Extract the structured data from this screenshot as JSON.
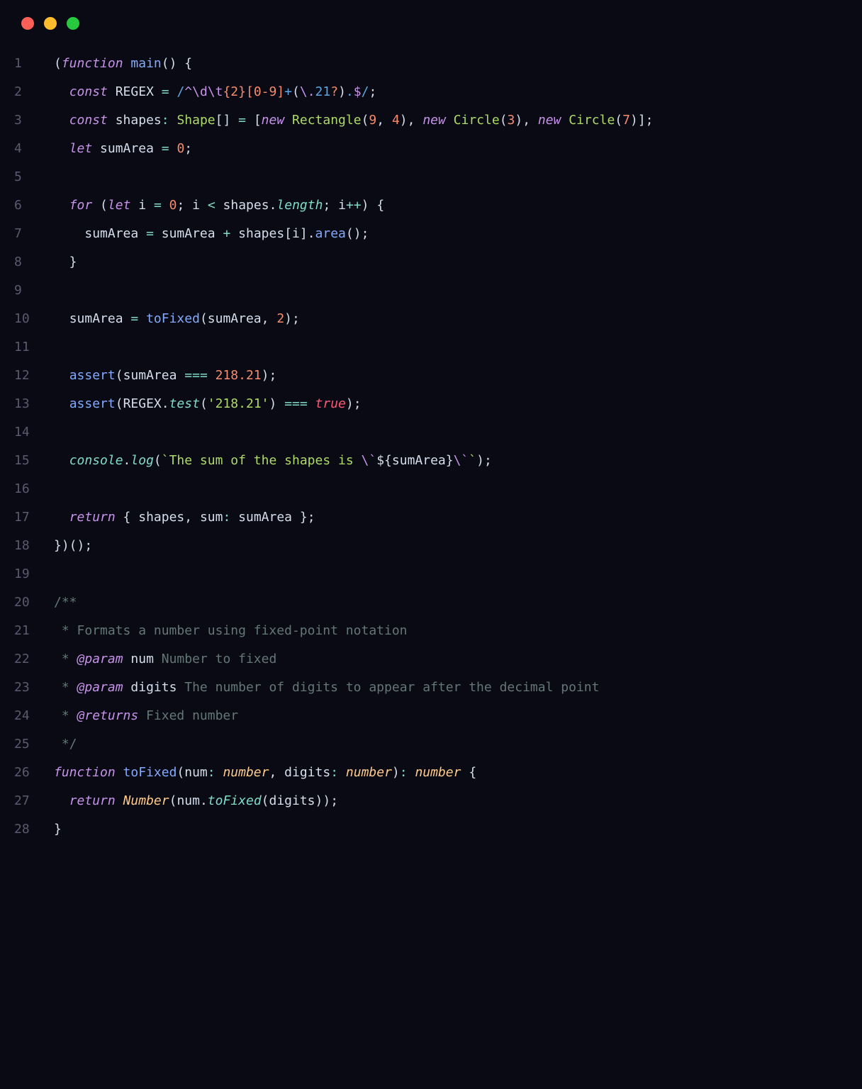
{
  "traffic": {
    "red": "#ff5f56",
    "yellow": "#ffbd2e",
    "green": "#27c93f"
  },
  "lineCount": 28,
  "tokens": {
    "l1": [
      [
        "punc",
        "("
      ],
      [
        "kw-it",
        "function"
      ],
      [
        "punc",
        " "
      ],
      [
        "callfn",
        "main"
      ],
      [
        "punc",
        "() {"
      ]
    ],
    "l2": [
      [
        "punc",
        "  "
      ],
      [
        "kw-it",
        "const"
      ],
      [
        "punc",
        " "
      ],
      [
        "ident",
        "REGEX"
      ],
      [
        "punc",
        " "
      ],
      [
        "op",
        "="
      ],
      [
        "punc",
        " "
      ],
      [
        "regex",
        "/"
      ],
      [
        "rxesc",
        "^\\d\\t"
      ],
      [
        "rxcls",
        "{2}"
      ],
      [
        "rxcls",
        "[0-9]"
      ],
      [
        "regex",
        "+"
      ],
      [
        "punc",
        "("
      ],
      [
        "rxesc",
        "\\."
      ],
      [
        "regex",
        "21"
      ],
      [
        "rxcls",
        "?"
      ],
      [
        "punc",
        ")"
      ],
      [
        "regex",
        "."
      ],
      [
        "rxesc",
        "$"
      ],
      [
        "regex",
        "/"
      ],
      [
        "punc",
        ";"
      ]
    ],
    "l3": [
      [
        "punc",
        "  "
      ],
      [
        "kw-it",
        "const"
      ],
      [
        "punc",
        " "
      ],
      [
        "ident",
        "shapes"
      ],
      [
        "op",
        ":"
      ],
      [
        "punc",
        " "
      ],
      [
        "class",
        "Shape"
      ],
      [
        "punc",
        "[] "
      ],
      [
        "op",
        "="
      ],
      [
        "punc",
        " ["
      ],
      [
        "kw-it",
        "new"
      ],
      [
        "punc",
        " "
      ],
      [
        "class",
        "Rectangle"
      ],
      [
        "punc",
        "("
      ],
      [
        "num",
        "9"
      ],
      [
        "punc",
        ", "
      ],
      [
        "num",
        "4"
      ],
      [
        "punc",
        "), "
      ],
      [
        "kw-it",
        "new"
      ],
      [
        "punc",
        " "
      ],
      [
        "class",
        "Circle"
      ],
      [
        "punc",
        "("
      ],
      [
        "num",
        "3"
      ],
      [
        "punc",
        "), "
      ],
      [
        "kw-it",
        "new"
      ],
      [
        "punc",
        " "
      ],
      [
        "class",
        "Circle"
      ],
      [
        "punc",
        "("
      ],
      [
        "num",
        "7"
      ],
      [
        "punc",
        ")];"
      ]
    ],
    "l4": [
      [
        "punc",
        "  "
      ],
      [
        "kw-it",
        "let"
      ],
      [
        "punc",
        " "
      ],
      [
        "ident",
        "sumArea"
      ],
      [
        "punc",
        " "
      ],
      [
        "op",
        "="
      ],
      [
        "punc",
        " "
      ],
      [
        "num",
        "0"
      ],
      [
        "punc",
        ";"
      ]
    ],
    "l5": [
      [
        "punc",
        ""
      ]
    ],
    "l6": [
      [
        "punc",
        "  "
      ],
      [
        "kw-it",
        "for"
      ],
      [
        "punc",
        " ("
      ],
      [
        "kw-it",
        "let"
      ],
      [
        "punc",
        " "
      ],
      [
        "ident",
        "i"
      ],
      [
        "punc",
        " "
      ],
      [
        "op",
        "="
      ],
      [
        "punc",
        " "
      ],
      [
        "num",
        "0"
      ],
      [
        "punc",
        "; "
      ],
      [
        "ident",
        "i"
      ],
      [
        "punc",
        " "
      ],
      [
        "op",
        "<"
      ],
      [
        "punc",
        " "
      ],
      [
        "ident",
        "shapes"
      ],
      [
        "punc",
        "."
      ],
      [
        "prop-it",
        "length"
      ],
      [
        "punc",
        "; "
      ],
      [
        "ident",
        "i"
      ],
      [
        "op",
        "++"
      ],
      [
        "punc",
        ") {"
      ]
    ],
    "l7": [
      [
        "punc",
        "    "
      ],
      [
        "ident",
        "sumArea"
      ],
      [
        "punc",
        " "
      ],
      [
        "op",
        "="
      ],
      [
        "punc",
        " "
      ],
      [
        "ident",
        "sumArea"
      ],
      [
        "punc",
        " "
      ],
      [
        "op",
        "+"
      ],
      [
        "punc",
        " "
      ],
      [
        "ident",
        "shapes"
      ],
      [
        "punc",
        "["
      ],
      [
        "ident",
        "i"
      ],
      [
        "punc",
        "]."
      ],
      [
        "callfn",
        "area"
      ],
      [
        "punc",
        "();"
      ]
    ],
    "l8": [
      [
        "punc",
        "  }"
      ]
    ],
    "l9": [
      [
        "punc",
        ""
      ]
    ],
    "l10": [
      [
        "punc",
        "  "
      ],
      [
        "ident",
        "sumArea"
      ],
      [
        "punc",
        " "
      ],
      [
        "op",
        "="
      ],
      [
        "punc",
        " "
      ],
      [
        "callfn",
        "toFixed"
      ],
      [
        "punc",
        "("
      ],
      [
        "ident",
        "sumArea"
      ],
      [
        "punc",
        ", "
      ],
      [
        "num",
        "2"
      ],
      [
        "punc",
        ");"
      ]
    ],
    "l11": [
      [
        "punc",
        ""
      ]
    ],
    "l12": [
      [
        "punc",
        "  "
      ],
      [
        "callfn",
        "assert"
      ],
      [
        "punc",
        "("
      ],
      [
        "ident",
        "sumArea"
      ],
      [
        "punc",
        " "
      ],
      [
        "op",
        "==="
      ],
      [
        "punc",
        " "
      ],
      [
        "num",
        "218.21"
      ],
      [
        "punc",
        ");"
      ]
    ],
    "l13": [
      [
        "punc",
        "  "
      ],
      [
        "callfn",
        "assert"
      ],
      [
        "punc",
        "("
      ],
      [
        "ident",
        "REGEX"
      ],
      [
        "punc",
        "."
      ],
      [
        "prop-it",
        "test"
      ],
      [
        "punc",
        "("
      ],
      [
        "str",
        "'218.21'"
      ],
      [
        "punc",
        ") "
      ],
      [
        "op",
        "==="
      ],
      [
        "punc",
        " "
      ],
      [
        "bool",
        "true"
      ],
      [
        "punc",
        ");"
      ]
    ],
    "l14": [
      [
        "punc",
        ""
      ]
    ],
    "l15": [
      [
        "punc",
        "  "
      ],
      [
        "prop-it",
        "console"
      ],
      [
        "punc",
        "."
      ],
      [
        "prop-it",
        "log"
      ],
      [
        "punc",
        "("
      ],
      [
        "tmpl",
        "`The sum of the shapes is "
      ],
      [
        "rxesc",
        "\\`"
      ],
      [
        "tmplExp",
        "${"
      ],
      [
        "ident",
        "sumArea"
      ],
      [
        "tmplExp",
        "}"
      ],
      [
        "rxesc",
        "\\`"
      ],
      [
        "tmpl",
        "`"
      ],
      [
        "punc",
        ");"
      ]
    ],
    "l16": [
      [
        "punc",
        ""
      ]
    ],
    "l17": [
      [
        "punc",
        "  "
      ],
      [
        "kw-it",
        "return"
      ],
      [
        "punc",
        " { "
      ],
      [
        "ident",
        "shapes"
      ],
      [
        "punc",
        ", "
      ],
      [
        "ident",
        "sum"
      ],
      [
        "op",
        ":"
      ],
      [
        "punc",
        " "
      ],
      [
        "ident",
        "sumArea"
      ],
      [
        "punc",
        " };"
      ]
    ],
    "l18": [
      [
        "punc",
        "})();"
      ]
    ],
    "l19": [
      [
        "punc",
        ""
      ]
    ],
    "l20": [
      [
        "cmt",
        "/**"
      ]
    ],
    "l21": [
      [
        "cmt",
        " * Formats a number using fixed-point notation"
      ]
    ],
    "l22": [
      [
        "cmt",
        " * "
      ],
      [
        "doctag",
        "@param"
      ],
      [
        "cmt",
        " "
      ],
      [
        "param",
        "num"
      ],
      [
        "cmt",
        " Number to fixed"
      ]
    ],
    "l23": [
      [
        "cmt",
        " * "
      ],
      [
        "doctag",
        "@param"
      ],
      [
        "cmt",
        " "
      ],
      [
        "param",
        "digits"
      ],
      [
        "cmt",
        " The number of digits to appear after the decimal point"
      ]
    ],
    "l24": [
      [
        "cmt",
        " * "
      ],
      [
        "doctag",
        "@returns"
      ],
      [
        "cmt",
        " Fixed number"
      ]
    ],
    "l25": [
      [
        "cmt",
        " */"
      ]
    ],
    "l26": [
      [
        "kw-it",
        "function"
      ],
      [
        "punc",
        " "
      ],
      [
        "callfn",
        "toFixed"
      ],
      [
        "punc",
        "("
      ],
      [
        "ident",
        "num"
      ],
      [
        "op",
        ":"
      ],
      [
        "punc",
        " "
      ],
      [
        "type",
        "number"
      ],
      [
        "punc",
        ", "
      ],
      [
        "ident",
        "digits"
      ],
      [
        "op",
        ":"
      ],
      [
        "punc",
        " "
      ],
      [
        "type",
        "number"
      ],
      [
        "punc",
        ")"
      ],
      [
        "op",
        ":"
      ],
      [
        "punc",
        " "
      ],
      [
        "type",
        "number"
      ],
      [
        "punc",
        " {"
      ]
    ],
    "l27": [
      [
        "punc",
        "  "
      ],
      [
        "kw-it",
        "return"
      ],
      [
        "punc",
        " "
      ],
      [
        "builtin",
        "Number"
      ],
      [
        "punc",
        "("
      ],
      [
        "ident",
        "num"
      ],
      [
        "punc",
        "."
      ],
      [
        "prop-it",
        "toFixed"
      ],
      [
        "punc",
        "("
      ],
      [
        "ident",
        "digits"
      ],
      [
        "punc",
        "));"
      ]
    ],
    "l28": [
      [
        "punc",
        "}"
      ]
    ]
  }
}
